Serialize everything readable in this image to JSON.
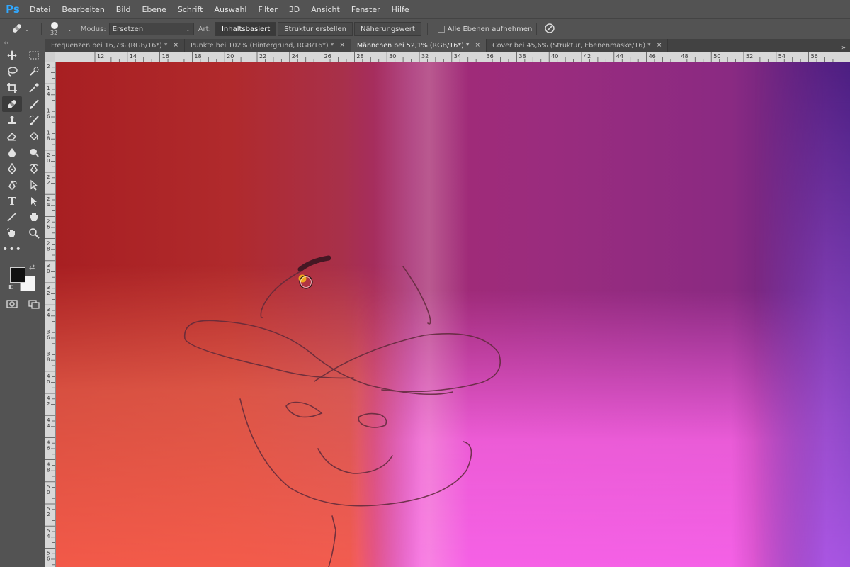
{
  "app": {
    "logo": "Ps"
  },
  "menu": [
    "Datei",
    "Bearbeiten",
    "Bild",
    "Ebene",
    "Schrift",
    "Auswahl",
    "Filter",
    "3D",
    "Ansicht",
    "Fenster",
    "Hilfe"
  ],
  "options": {
    "brush_size": "32",
    "mode_label": "Modus:",
    "mode_value": "Ersetzen",
    "type_label": "Art:",
    "type_buttons": [
      "Inhaltsbasiert",
      "Struktur erstellen",
      "Näherungswert"
    ],
    "active_type": "Inhaltsbasiert",
    "sample_all_label": "Alle Ebenen aufnehmen",
    "sample_all_checked": false
  },
  "tabs": [
    {
      "label": "Frequenzen bei 16,7% (RGB/16*) *",
      "active": false
    },
    {
      "label": "Punkte bei 102% (Hintergrund, RGB/16*) *",
      "active": false
    },
    {
      "label": "Männchen bei 52,1% (RGB/16*) *",
      "active": true
    },
    {
      "label": "Cover bei 45,6% (Struktur, Ebenenmaske/16) *",
      "active": false
    }
  ],
  "tab_close": "×",
  "tab_overflow": "»",
  "ruler_top_labels": [
    "12",
    "14",
    "16",
    "18",
    "20",
    "22",
    "24",
    "26",
    "28",
    "30",
    "32",
    "34",
    "36",
    "38",
    "40",
    "42",
    "44",
    "46",
    "48",
    "50",
    "52",
    "54",
    "56"
  ],
  "ruler_left_labels": [
    "2",
    "1 4",
    "1 6",
    "1 8",
    "2 0",
    "2 2",
    "2 4",
    "2 6",
    "2 8",
    "3 0",
    "3 2",
    "3 4",
    "3 6",
    "3 8",
    "4 0",
    "4 2",
    "4 4",
    "4 6",
    "4 8",
    "5 0",
    "5 2",
    "5 4",
    "5 6"
  ],
  "colors": {
    "foreground": "#111111",
    "background": "#f5f5f5",
    "accent": "#31a8ff",
    "cursor_dot": "#f0a81e"
  },
  "toolbar": {
    "active_tool": "spot-healing-brush-icon"
  }
}
